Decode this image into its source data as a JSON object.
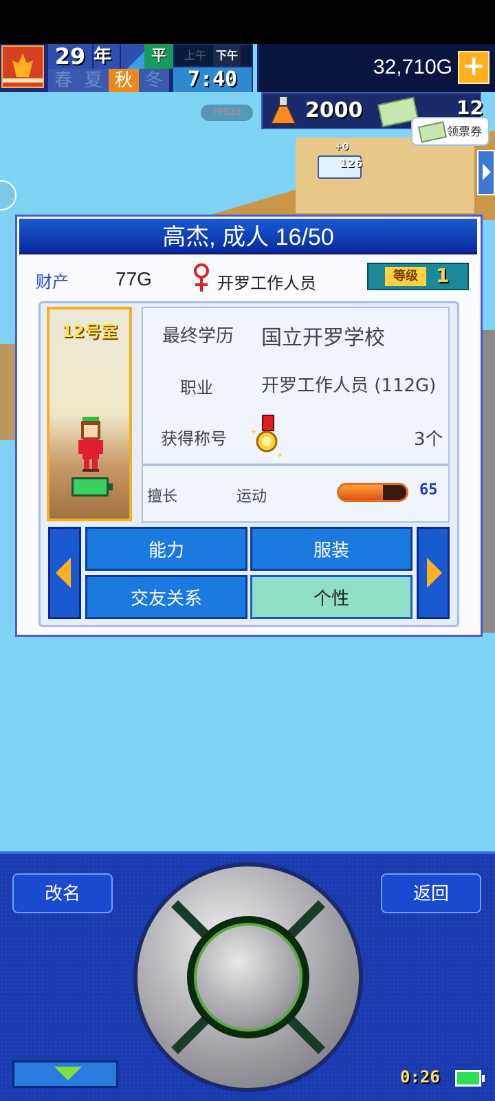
{
  "status_bar": {
    "year": "29",
    "year_unit": "年",
    "weekday": "平日",
    "am": "上午",
    "pm": "下午",
    "seasons": [
      "春",
      "夏",
      "秋",
      "冬"
    ],
    "active_season": "秋",
    "time": "7:40",
    "money": "32,710G",
    "add_money": "+",
    "fps": "FPS20",
    "research_points": "2000",
    "tickets": "12",
    "coupon_label": "领票券"
  },
  "scene": {
    "bubble_value": "126",
    "plus_zero": "+0"
  },
  "dialog": {
    "title": "高杰, 成人 16/50",
    "assets_label": "财产",
    "assets_value": "77G",
    "job": "开罗工作人员",
    "level_label": "等级",
    "level_value": "1",
    "room": "12号室",
    "education_label": "最终学历",
    "education_value": "国立开罗学校",
    "occupation_label": "职业",
    "occupation_value": "开罗工作人员 (112G)",
    "titles_label": "获得称号",
    "titles_count": "3个",
    "skill_label": "擅长",
    "skill_name": "运动",
    "skill_value": "65",
    "skill_fraction": 0.65,
    "tabs": {
      "ability": "能力",
      "outfit": "服装",
      "relations": "交友关系",
      "personality": "个性"
    }
  },
  "controls": {
    "rename": "改名",
    "back": "返回",
    "timer": "0:26"
  },
  "colors": {
    "accent": "#1a5ad0",
    "selected_tab": "#90e0c8",
    "background": "#7fd3f5"
  }
}
